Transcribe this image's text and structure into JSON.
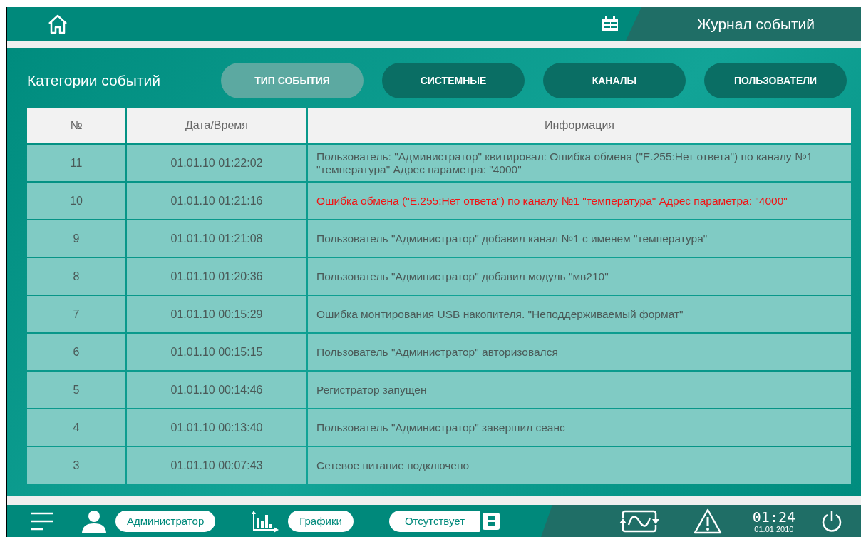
{
  "header": {
    "title": "Журнал событий"
  },
  "categories": {
    "label": "Категории событий",
    "tabs": [
      {
        "label": "ТИП СОБЫТИЯ",
        "selected": true
      },
      {
        "label": "СИСТЕМНЫЕ",
        "selected": false
      },
      {
        "label": "КАНАЛЫ",
        "selected": false
      },
      {
        "label": "ПОЛЬЗОВАТЕЛИ",
        "selected": false
      }
    ]
  },
  "table": {
    "columns": [
      "№",
      "Дата/Время",
      "Информация"
    ],
    "rows": [
      {
        "number": "11",
        "datetime": "01.01.10 01:22:02",
        "info": "Пользователь: \"Администратор\" квитировал: Ошибка обмена (\"Е.255:Нет ответа\") по каналу №1 \"температура\" Адрес параметра: \"4000\"",
        "kind": "info"
      },
      {
        "number": "10",
        "datetime": "01.01.10 01:21:16",
        "info": "Ошибка обмена (\"Е.255:Нет ответа\") по каналу №1 \"температура\" Адрес параметра: \"4000\"",
        "kind": "error"
      },
      {
        "number": "9",
        "datetime": "01.01.10 01:21:08",
        "info": "Пользователь \"Администратор\" добавил канал №1 с именем \"температура\"",
        "kind": "info"
      },
      {
        "number": "8",
        "datetime": "01.01.10 01:20:36",
        "info": "Пользователь \"Администратор\" добавил модуль \"мв210\"",
        "kind": "info"
      },
      {
        "number": "7",
        "datetime": "01.01.10 00:15:29",
        "info": "Ошибка монтирования USB накопителя. \"Неподдерживаемый формат\"",
        "kind": "info"
      },
      {
        "number": "6",
        "datetime": "01.01.10 00:15:15",
        "info": "Пользователь \"Администратор\" авторизовался",
        "kind": "info"
      },
      {
        "number": "5",
        "datetime": "01.01.10 00:14:46",
        "info": "Регистратор запущен",
        "kind": "info"
      },
      {
        "number": "4",
        "datetime": "01.01.10 00:13:40",
        "info": "Пользователь \"Администратор\" завершил сеанс",
        "kind": "info"
      },
      {
        "number": "3",
        "datetime": "01.01.10 00:07:43",
        "info": "Сетевое питание подключено",
        "kind": "info"
      }
    ]
  },
  "status_bar": {
    "user": "Администратор",
    "charts": "Графики",
    "storage": "Отсутствует",
    "time": "01:24",
    "date": "01.01.2010"
  }
}
